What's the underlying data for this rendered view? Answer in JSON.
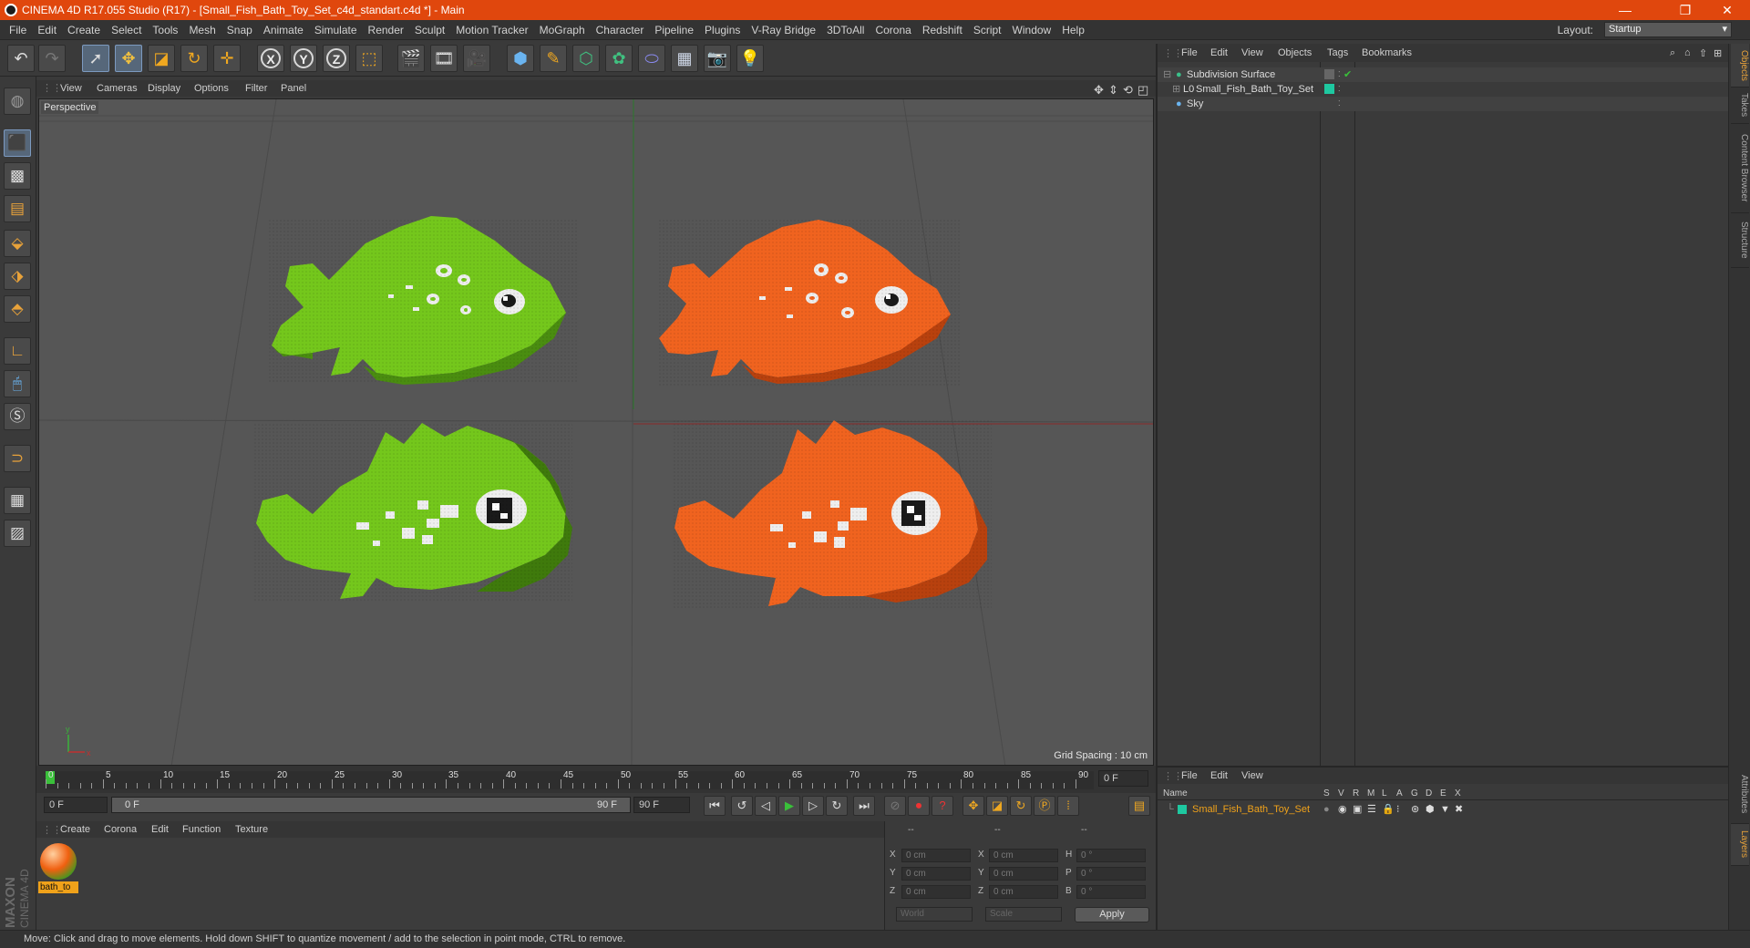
{
  "titlebar": {
    "title": "CINEMA 4D R17.055 Studio (R17) - [Small_Fish_Bath_Toy_Set_c4d_standart.c4d *] - Main",
    "minimize": "—",
    "maximize": "❐",
    "close": "✕"
  },
  "menu": [
    "File",
    "Edit",
    "Create",
    "Select",
    "Tools",
    "Mesh",
    "Snap",
    "Animate",
    "Simulate",
    "Render",
    "Sculpt",
    "Motion Tracker",
    "MoGraph",
    "Character",
    "Pipeline",
    "Plugins",
    "V-Ray Bridge",
    "3DToAll",
    "Corona",
    "Redshift",
    "Script",
    "Window",
    "Help"
  ],
  "layout": {
    "label": "Layout:",
    "value": "Startup"
  },
  "toolbar_icons": {
    "xyz": [
      "X",
      "Y",
      "Z"
    ]
  },
  "viewport": {
    "menu": [
      "View",
      "Cameras",
      "Display",
      "Options",
      "Filter",
      "Panel"
    ],
    "label": "Perspective",
    "grid_spacing": "Grid Spacing : 10 cm",
    "colors": {
      "green": "#74c71c",
      "orange": "#f0631f"
    }
  },
  "timeline": {
    "ticks": [
      "0",
      "5",
      "10",
      "15",
      "20",
      "25",
      "30",
      "35",
      "40",
      "45",
      "50",
      "55",
      "60",
      "65",
      "70",
      "75",
      "80",
      "85",
      "90"
    ],
    "end_frame_box": "0 F",
    "current": "0 F",
    "range_start": "0 F",
    "range_end": "90 F",
    "max": "90 F"
  },
  "material": {
    "menu": [
      "Create",
      "Corona",
      "Edit",
      "Function",
      "Texture"
    ],
    "items": [
      {
        "name": "bath_to"
      }
    ]
  },
  "coords": {
    "headers": [
      "--",
      "--",
      "--"
    ],
    "rows": [
      {
        "a": "X",
        "av": "0 cm",
        "b": "X",
        "bv": "0 cm",
        "c": "H",
        "cv": "0 °"
      },
      {
        "a": "Y",
        "av": "0 cm",
        "b": "Y",
        "bv": "0 cm",
        "c": "P",
        "cv": "0 °"
      },
      {
        "a": "Z",
        "av": "0 cm",
        "b": "Z",
        "bv": "0 cm",
        "c": "B",
        "cv": "0 °"
      }
    ],
    "world": "World",
    "scale": "Scale",
    "apply": "Apply"
  },
  "objects": {
    "menu": [
      "File",
      "Edit",
      "View",
      "Objects",
      "Tags",
      "Bookmarks"
    ],
    "items": [
      "Subdivision Surface",
      "Small_Fish_Bath_Toy_Set",
      "Sky"
    ]
  },
  "layers": {
    "menu": [
      "File",
      "Edit",
      "View"
    ],
    "name_header": "Name",
    "cols": [
      "S",
      "V",
      "R",
      "M",
      "L",
      "A",
      "G",
      "D",
      "E",
      "X"
    ],
    "item": "Small_Fish_Bath_Toy_Set",
    "item_color": "#f0a21a"
  },
  "right_tabs": [
    "Objects",
    "Takes",
    "Content Browser",
    "Structure",
    "Attributes",
    "Layers"
  ],
  "brand": {
    "maxon": "MAXON",
    "cinema": "CINEMA 4D"
  },
  "status": "Move: Click and drag to move elements. Hold down SHIFT to quantize movement / add to the selection in point mode, CTRL to remove."
}
